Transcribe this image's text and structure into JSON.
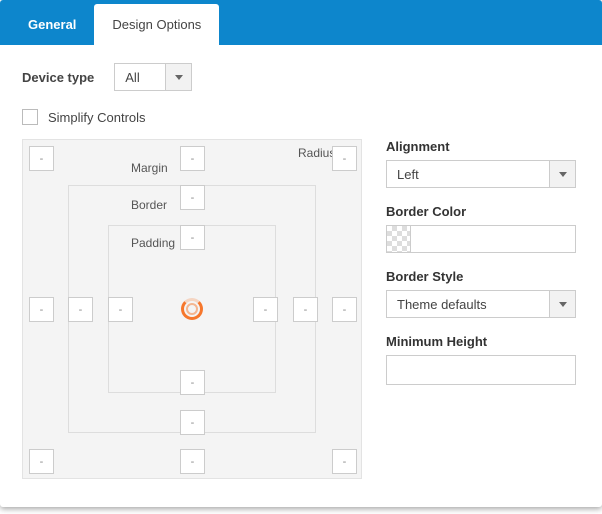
{
  "tabs": {
    "general": "General",
    "design": "Design Options"
  },
  "device": {
    "label": "Device type",
    "value": "All"
  },
  "simplify": {
    "label": "Simplify Controls"
  },
  "box": {
    "margin_label": "Margin",
    "border_label": "Border",
    "padding_label": "Padding",
    "radius_label": "Radius",
    "dash": "-"
  },
  "side": {
    "alignment": {
      "label": "Alignment",
      "value": "Left"
    },
    "border_color": {
      "label": "Border Color"
    },
    "border_style": {
      "label": "Border Style",
      "value": "Theme defaults"
    },
    "min_height": {
      "label": "Minimum Height"
    }
  }
}
